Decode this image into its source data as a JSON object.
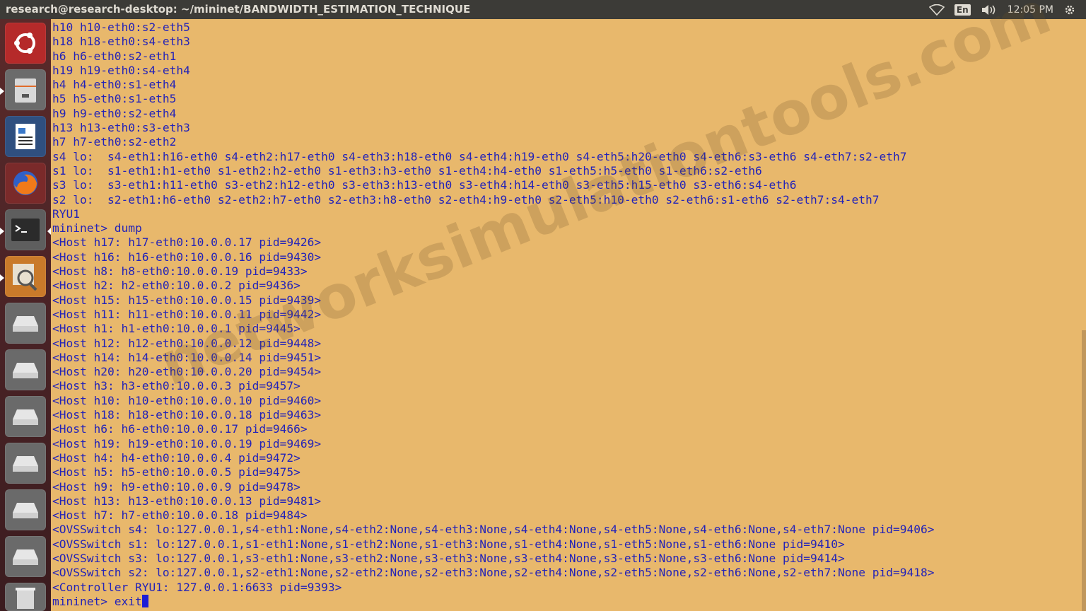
{
  "window": {
    "title": "research@research-desktop: ~/mininet/BANDWIDTH_ESTIMATION_TECHNIQUE"
  },
  "tray": {
    "language": "En",
    "time": "12:05 PM",
    "icons": [
      "wifi-icon",
      "keyboard-language-icon",
      "volume-icon",
      "gear-icon"
    ]
  },
  "launcher": {
    "items": [
      {
        "name": "dash-home",
        "icon": "ubuntu-logo-icon"
      },
      {
        "name": "files",
        "icon": "file-cabinet-icon"
      },
      {
        "name": "libreoffice-writer",
        "icon": "writer-document-icon"
      },
      {
        "name": "firefox",
        "icon": "firefox-icon"
      },
      {
        "name": "terminal",
        "icon": "terminal-icon"
      },
      {
        "name": "image-viewer",
        "icon": "magnifier-icon"
      },
      {
        "name": "drive-1",
        "icon": "drive-icon"
      },
      {
        "name": "drive-2",
        "icon": "drive-icon"
      },
      {
        "name": "drive-3",
        "icon": "drive-icon"
      },
      {
        "name": "drive-4",
        "icon": "drive-icon"
      },
      {
        "name": "drive-5",
        "icon": "drive-icon"
      },
      {
        "name": "drive-6",
        "icon": "drive-icon"
      },
      {
        "name": "trash",
        "icon": "trash-icon"
      }
    ]
  },
  "terminal": {
    "lines": [
      "h10 h10-eth0:s2-eth5",
      "h18 h18-eth0:s4-eth3",
      "h6 h6-eth0:s2-eth1",
      "h19 h19-eth0:s4-eth4",
      "h4 h4-eth0:s1-eth4",
      "h5 h5-eth0:s1-eth5",
      "h9 h9-eth0:s2-eth4",
      "h13 h13-eth0:s3-eth3",
      "h7 h7-eth0:s2-eth2",
      "s4 lo:  s4-eth1:h16-eth0 s4-eth2:h17-eth0 s4-eth3:h18-eth0 s4-eth4:h19-eth0 s4-eth5:h20-eth0 s4-eth6:s3-eth6 s4-eth7:s2-eth7",
      "s1 lo:  s1-eth1:h1-eth0 s1-eth2:h2-eth0 s1-eth3:h3-eth0 s1-eth4:h4-eth0 s1-eth5:h5-eth0 s1-eth6:s2-eth6",
      "s3 lo:  s3-eth1:h11-eth0 s3-eth2:h12-eth0 s3-eth3:h13-eth0 s3-eth4:h14-eth0 s3-eth5:h15-eth0 s3-eth6:s4-eth6",
      "s2 lo:  s2-eth1:h6-eth0 s2-eth2:h7-eth0 s2-eth3:h8-eth0 s2-eth4:h9-eth0 s2-eth5:h10-eth0 s2-eth6:s1-eth6 s2-eth7:s4-eth7",
      "RYU1",
      "mininet> dump",
      "<Host h17: h17-eth0:10.0.0.17 pid=9426>",
      "<Host h16: h16-eth0:10.0.0.16 pid=9430>",
      "<Host h8: h8-eth0:10.0.0.19 pid=9433>",
      "<Host h2: h2-eth0:10.0.0.2 pid=9436>",
      "<Host h15: h15-eth0:10.0.0.15 pid=9439>",
      "<Host h11: h11-eth0:10.0.0.11 pid=9442>",
      "<Host h1: h1-eth0:10.0.0.1 pid=9445>",
      "<Host h12: h12-eth0:10.0.0.12 pid=9448>",
      "<Host h14: h14-eth0:10.0.0.14 pid=9451>",
      "<Host h20: h20-eth0:10.0.0.20 pid=9454>",
      "<Host h3: h3-eth0:10.0.0.3 pid=9457>",
      "<Host h10: h10-eth0:10.0.0.10 pid=9460>",
      "<Host h18: h18-eth0:10.0.0.18 pid=9463>",
      "<Host h6: h6-eth0:10.0.0.17 pid=9466>",
      "<Host h19: h19-eth0:10.0.0.19 pid=9469>",
      "<Host h4: h4-eth0:10.0.0.4 pid=9472>",
      "<Host h5: h5-eth0:10.0.0.5 pid=9475>",
      "<Host h9: h9-eth0:10.0.0.9 pid=9478>",
      "<Host h13: h13-eth0:10.0.0.13 pid=9481>",
      "<Host h7: h7-eth0:10.0.0.18 pid=9484>",
      "<OVSSwitch s4: lo:127.0.0.1,s4-eth1:None,s4-eth2:None,s4-eth3:None,s4-eth4:None,s4-eth5:None,s4-eth6:None,s4-eth7:None pid=9406>",
      "<OVSSwitch s1: lo:127.0.0.1,s1-eth1:None,s1-eth2:None,s1-eth3:None,s1-eth4:None,s1-eth5:None,s1-eth6:None pid=9410>",
      "<OVSSwitch s3: lo:127.0.0.1,s3-eth1:None,s3-eth2:None,s3-eth3:None,s3-eth4:None,s3-eth5:None,s3-eth6:None pid=9414>",
      "<OVSSwitch s2: lo:127.0.0.1,s2-eth1:None,s2-eth2:None,s2-eth3:None,s2-eth4:None,s2-eth5:None,s2-eth6:None,s2-eth7:None pid=9418>",
      "<Controller RYU1: 127.0.0.1:6633 pid=9393>"
    ],
    "prompt_line": "mininet> exit"
  },
  "watermark": "networksimulationtools.com",
  "colors": {
    "terminal_background": "#e8b86c",
    "terminal_text": "#2323b8",
    "topbar": "#3c3b37",
    "launcher": "#4a2326"
  }
}
